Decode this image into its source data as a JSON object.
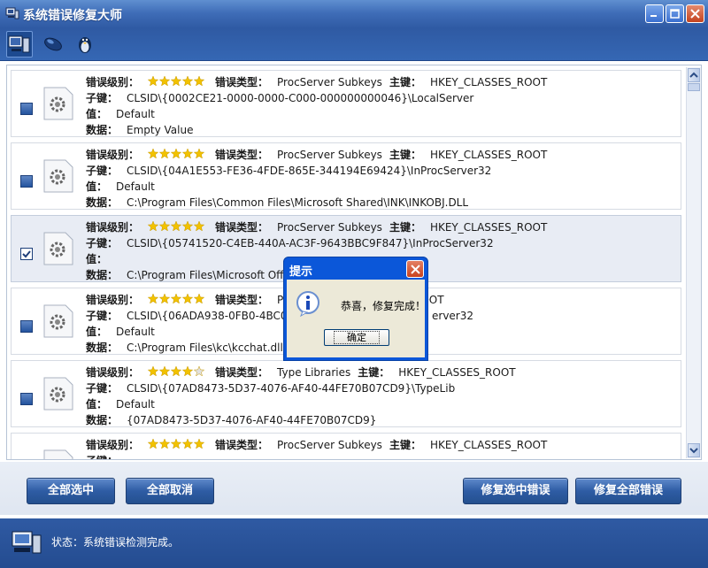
{
  "window": {
    "title": "系统错误修复大师"
  },
  "toolbar": {
    "icons": [
      "computer-icon",
      "mouse-icon",
      "penguin-icon"
    ]
  },
  "labels": {
    "level": "错误级别：",
    "type": "错误类型：",
    "main_key": "主键：",
    "sub_key": "子键：",
    "value": "值：",
    "data": "数据："
  },
  "items": [
    {
      "rating": 5,
      "checked": false,
      "type": "ProcServer Subkeys",
      "main_key": "HKEY_CLASSES_ROOT",
      "sub_key": "CLSID\\{0002CE21-0000-0000-C000-000000000046}\\LocalServer",
      "value": "Default",
      "data": "Empty Value"
    },
    {
      "rating": 5,
      "checked": false,
      "type": "ProcServer Subkeys",
      "main_key": "HKEY_CLASSES_ROOT",
      "sub_key": "CLSID\\{04A1E553-FE36-4FDE-865E-344194E69424}\\InProcServer32",
      "value": "Default",
      "data": "C:\\Program Files\\Common Files\\Microsoft Shared\\INK\\INKOBJ.DLL"
    },
    {
      "rating": 5,
      "checked": true,
      "type": "ProcServer Subkeys",
      "main_key": "HKEY_CLASSES_ROOT",
      "sub_key": "CLSID\\{05741520-C4EB-440A-AC3F-9643BBC9F847}\\InProcServer32",
      "value": "",
      "data": "C:\\Program Files\\Microsoft Office\\                          .dll"
    },
    {
      "rating": 5,
      "checked": false,
      "type": "Pro",
      "main_key": "EY_CLASSES_ROOT",
      "sub_key": "CLSID\\{06ADA938-0FB0-4BC0-B",
      "sub_key_tail": "erver32",
      "value": "Default",
      "data": "C:\\Program Files\\kc\\kcchat.dll"
    },
    {
      "rating": 4,
      "checked": false,
      "type": "Type Libraries",
      "main_key": "HKEY_CLASSES_ROOT",
      "sub_key": "CLSID\\{07AD8473-5D37-4076-AF40-44FE70B07CD9}\\TypeLib",
      "value": "Default",
      "data": "{07AD8473-5D37-4076-AF40-44FE70B07CD9}"
    },
    {
      "rating": 5,
      "checked": false,
      "type": "ProcServer Subkeys",
      "main_key": "HKEY_CLASSES_ROOT",
      "sub_key": "",
      "value": "",
      "data": ""
    }
  ],
  "buttons": {
    "select_all": "全部选中",
    "cancel_all": "全部取消",
    "fix_selected": "修复选中错误",
    "fix_all": "修复全部错误"
  },
  "status": {
    "text": "状态：系统错误检测完成。"
  },
  "dialog": {
    "title": "提示",
    "message": "恭喜，修复完成！",
    "ok": "确定"
  },
  "colors": {
    "title_blue": "#3f6db8",
    "dialog_blue": "#0b57d9",
    "star": "#f2c200"
  }
}
